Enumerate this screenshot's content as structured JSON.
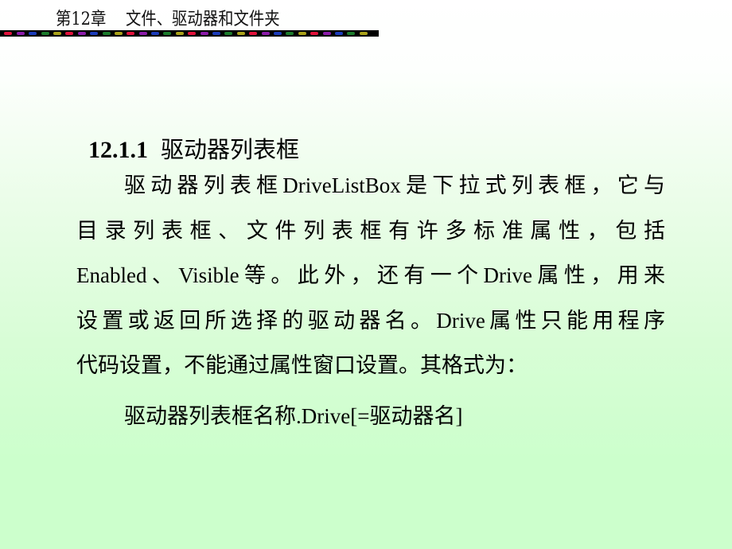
{
  "header": {
    "chapter_title": "第12章    文件、驱动器和文件夹",
    "decorative_bar_colors": [
      "#e0103a",
      "#8a1aa8",
      "#1a3ab8",
      "#1a7a2a",
      "#a8a018"
    ]
  },
  "section": {
    "number": "12.1.1",
    "title": "驱动器列表框"
  },
  "paragraph": {
    "lines": [
      "驱动器列表框DriveListBox是下拉式列表框，它与",
      "目录列表框、文件列表框有许多标准属性，包括",
      "Enabled、Visible等。此外，还有一个Drive属性，用来",
      "设置或返回所选择的驱动器名。Drive属性只能用程序",
      "代码设置，不能通过属性窗口设置。其格式为："
    ]
  },
  "syntax": {
    "text": "驱动器列表框名称.Drive[=驱动器名]"
  },
  "colors": {
    "background_top": "#ffffff",
    "background_bottom": "#ccffcc",
    "text": "#000000"
  }
}
